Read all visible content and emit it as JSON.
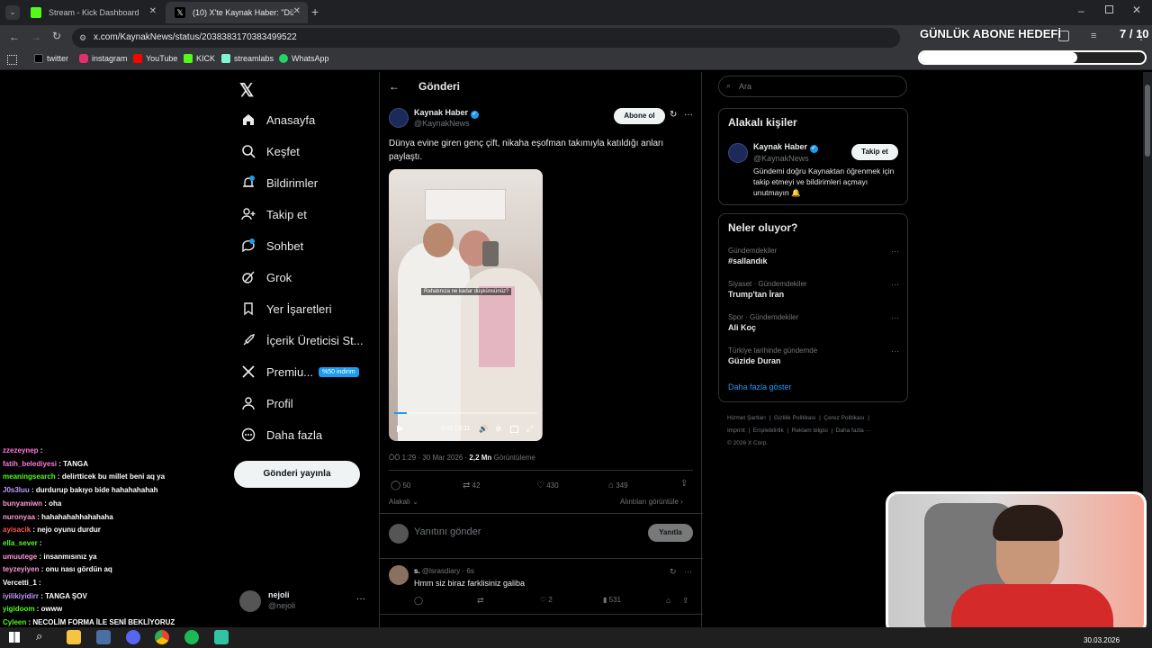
{
  "browser": {
    "tabs": [
      {
        "title": "Stream - Kick Dashboard",
        "favicon_color": "#53fc18"
      },
      {
        "title": "(10) X'te Kaynak Haber: \"Dünya",
        "favicon_color": "#000000"
      }
    ],
    "url": "x.com/KaynakNews/status/2038383170383499522",
    "bookmarks": [
      {
        "label": "twitter",
        "color": "#000000"
      },
      {
        "label": "instagram",
        "color": "#e1306c"
      },
      {
        "label": "YouTube",
        "color": "#ff0000"
      },
      {
        "label": "KICK",
        "color": "#53fc18"
      },
      {
        "label": "streamlabs",
        "color": "#80f5d2"
      },
      {
        "label": "WhatsApp",
        "color": "#25d366"
      }
    ]
  },
  "overlay": {
    "goal_title": "GÜNLÜK ABONE HEDEFİ",
    "goal_count": "7 / 10",
    "goal_progress": 0.7
  },
  "sidebar": {
    "items": [
      {
        "label": "Anasayfa",
        "icon": "home-icon"
      },
      {
        "label": "Keşfet",
        "icon": "search-icon"
      },
      {
        "label": "Bildirimler",
        "icon": "bell-icon"
      },
      {
        "label": "Takip et",
        "icon": "follow-icon"
      },
      {
        "label": "Sohbet",
        "icon": "chat-icon"
      },
      {
        "label": "Grok",
        "icon": "grok-icon"
      },
      {
        "label": "Yer İşaretleri",
        "icon": "bookmark-icon"
      },
      {
        "label": "İçerik Üreticisi St...",
        "icon": "rocket-icon"
      },
      {
        "label": "Premiu...",
        "icon": "x-icon"
      },
      {
        "label": "Profil",
        "icon": "profile-icon"
      },
      {
        "label": "Daha fazla",
        "icon": "more-icon"
      }
    ],
    "premium_badge": "%50 indirim",
    "post_button": "Gönderi yayınla",
    "user": {
      "name": "nejoli",
      "handle": "@nejoli"
    }
  },
  "post": {
    "header_title": "Gönderi",
    "author": "Kaynak Haber",
    "handle": "@KaynakNews",
    "subscribe_label": "Abone ol",
    "text": "Dünya evine giren genç çift, nikaha eşofman takımıyla katıldığı anları paylaştı.",
    "video_caption": "Rahatınıza ne kadar düşkünsünüz?",
    "video_time": "0:01 / 0:11",
    "video_progress": 0.09,
    "timestamp": "ÖÖ 1:29 · 30 Mar 2026 ·",
    "views": "2,2 Mn",
    "views_label": "Görüntüleme",
    "stats": {
      "replies": "50",
      "reposts": "42",
      "likes": "430",
      "bookmarks": "349"
    },
    "relevant_label": "Alakalı",
    "quotes_label": "Alıntıları görüntüle",
    "reply_placeholder": "Yanıtını gönder",
    "reply_button": "Yanıtla"
  },
  "reply": {
    "name": "s.",
    "handle": "@lsrasdiary · 6s",
    "text": "Hmm siz biraz farklisiniz galiba",
    "likes": "2",
    "views": "531"
  },
  "right": {
    "search_placeholder": "Ara",
    "relevant_title": "Alakalı kişiler",
    "person_name": "Kaynak Haber",
    "person_handle": "@KaynakNews",
    "person_bio": "Gündemi doğru Kaynaktan öğrenmek için takip etmeyi ve bildirimleri açmayı unutmayın 🔔",
    "follow_button": "Takip et",
    "trends_title": "Neler oluyor?",
    "trends": [
      {
        "category": "Gündemdekiler",
        "topic": "#sallandık"
      },
      {
        "category": "Siyaset · Gündemdekiler",
        "topic": "Trump'tan İran"
      },
      {
        "category": "Spor · Gündemdekiler",
        "topic": "Ali Koç"
      },
      {
        "category": "Türkiye tarihinde gündemde",
        "topic": "Güzide Duran"
      }
    ],
    "show_more": "Daha fazla göster",
    "footer": [
      "Hizmet Şartları",
      "Gizlilik Politikası",
      "Çerez Politikası",
      "Imprint",
      "Erişilebilirlik",
      "Reklam bilgisi",
      "Daha fazla ···",
      "© 2026 X Corp."
    ]
  },
  "chat": [
    {
      "user": "zzezeynep",
      "msg": "",
      "color": "#ff7ad9"
    },
    {
      "user": "fatih_belediyesi",
      "msg": "TANGA",
      "color": "#ff7ad9"
    },
    {
      "user": "meaningsearch",
      "msg": "delirtticek bu millet beni aq ya",
      "color": "#53fc18"
    },
    {
      "user": "J0s3luu",
      "msg": "durdurup bakıyo bide hahahahahah",
      "color": "#c39bff"
    },
    {
      "user": "bunyamiwn",
      "msg": "oha",
      "color": "#ff9ad5"
    },
    {
      "user": "nuronyaa",
      "msg": "hahahahahhahahaha",
      "color": "#ff9ad5"
    },
    {
      "user": "ayisacik",
      "msg": "nejo oyunu durdur",
      "color": "#ff5555"
    },
    {
      "user": "ella_sever",
      "msg": "",
      "color": "#53fc18"
    },
    {
      "user": "umuutege",
      "msg": "insanmısınız ya",
      "color": "#ff9ad5"
    },
    {
      "user": "teyzeyiyen",
      "msg": "onu nası gördün aq",
      "color": "#ff9ad5"
    },
    {
      "user": "Vercetti_1",
      "msg": "",
      "color": "#ffffff"
    },
    {
      "user": "iyilikiyidirr",
      "msg": "TANGA ŞOV",
      "color": "#c39bff"
    },
    {
      "user": "yigidoom",
      "msg": "owww",
      "color": "#53fc18"
    },
    {
      "user": "Cyleen",
      "msg": "NECOLİM FORMA İLE SENİ BEKLİYORUZ",
      "color": "#53fc18"
    }
  ],
  "taskbar": {
    "date": "30.03.2026"
  }
}
